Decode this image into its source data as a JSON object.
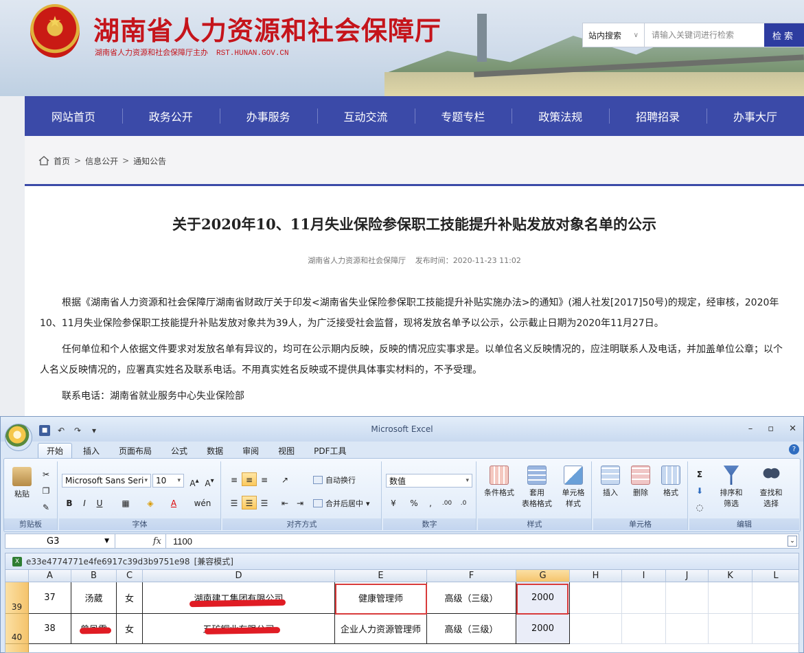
{
  "site": {
    "title": "湖南省人力资源和社会保障厅",
    "subtitle": "湖南省人力资源和社会保障厅主办",
    "domain": "RST.HUNAN.GOV.CN",
    "search_scope": "站内搜索",
    "search_placeholder": "请输入关键词进行检索",
    "search_button": "检索",
    "brand_color": "#3b4aa8",
    "title_color": "#c5141b"
  },
  "nav": [
    "网站首页",
    "政务公开",
    "办事服务",
    "互动交流",
    "专题专栏",
    "政策法规",
    "招聘招录",
    "办事大厅"
  ],
  "breadcrumb": [
    "首页",
    "信息公开",
    "通知公告"
  ],
  "article": {
    "title": "关于2020年10、11月失业保险参保职工技能提升补贴发放对象名单的公示",
    "publisher": "湖南省人力资源和社会保障厅",
    "publish_label": "发布时间：",
    "publish_time": "2020-11-23 11:02",
    "paragraphs": [
      "根据《湖南省人力资源和社会保障厅湖南省财政厅关于印发<湖南省失业保险参保职工技能提升补贴实施办法>的通知》(湘人社发[2017]50号)的规定，经审核，2020年10、11月失业保险参保职工技能提升补贴发放对象共为39人，为广泛接受社会监督，现将发放名单予以公示，公示截止日期为2020年11月27日。",
      "任何单位和个人依据文件要求对发放名单有异议的，均可在公示期内反映，反映的情况应实事求是。以单位名义反映情况的，应注明联系人及电话，并加盖单位公章；以个人名义反映情况的，应署真实姓名及联系电话。不用真实姓名反映或不提供具体事实材料的，不予受理。",
      "联系电话：湖南省就业服务中心失业保险部"
    ]
  },
  "excel": {
    "app_title": "Microsoft Excel",
    "tabs": [
      "开始",
      "插入",
      "页面布局",
      "公式",
      "数据",
      "审阅",
      "视图",
      "PDF工具"
    ],
    "active_tab": "开始",
    "groups": {
      "clipboard": {
        "label": "剪贴板",
        "paste": "粘贴"
      },
      "font": {
        "label": "字体",
        "font_name": "Microsoft Sans Seri",
        "font_size": "10"
      },
      "alignment": {
        "label": "对齐方式",
        "wrap": "自动换行",
        "merge": "合并后居中"
      },
      "number": {
        "label": "数字",
        "format": "数值"
      },
      "styles": {
        "label": "样式",
        "cond": "条件格式",
        "table1": "套用",
        "table2": "表格格式",
        "cell1": "单元格",
        "cell2": "样式"
      },
      "cells": {
        "label": "单元格",
        "insert": "插入",
        "delete": "删除",
        "format": "格式"
      },
      "editing": {
        "label": "编辑",
        "sort1": "排序和",
        "sort2": "筛选",
        "find1": "查找和",
        "find2": "选择"
      }
    },
    "name_box": "G3",
    "formula_value": "1100",
    "doc_name": "e33e4774771e4fe6917c39d3b9751e98",
    "doc_mode": "[兼容模式]",
    "columns": [
      "A",
      "B",
      "C",
      "D",
      "E",
      "F",
      "G",
      "H",
      "I",
      "J",
      "K",
      "L"
    ],
    "selected_column": "G",
    "rows": [
      {
        "num": "39",
        "cells": [
          "37",
          "汤葳",
          "女",
          "湖南建工集团有限公司",
          "健康管理师",
          "高级（三级）",
          "2000"
        ]
      },
      {
        "num": "40",
        "cells": [
          "38",
          "曾凤霞",
          "女",
          "五矿铜业有限公司",
          "企业人力资源管理师",
          "高级（三级）",
          "2000"
        ]
      }
    ]
  }
}
